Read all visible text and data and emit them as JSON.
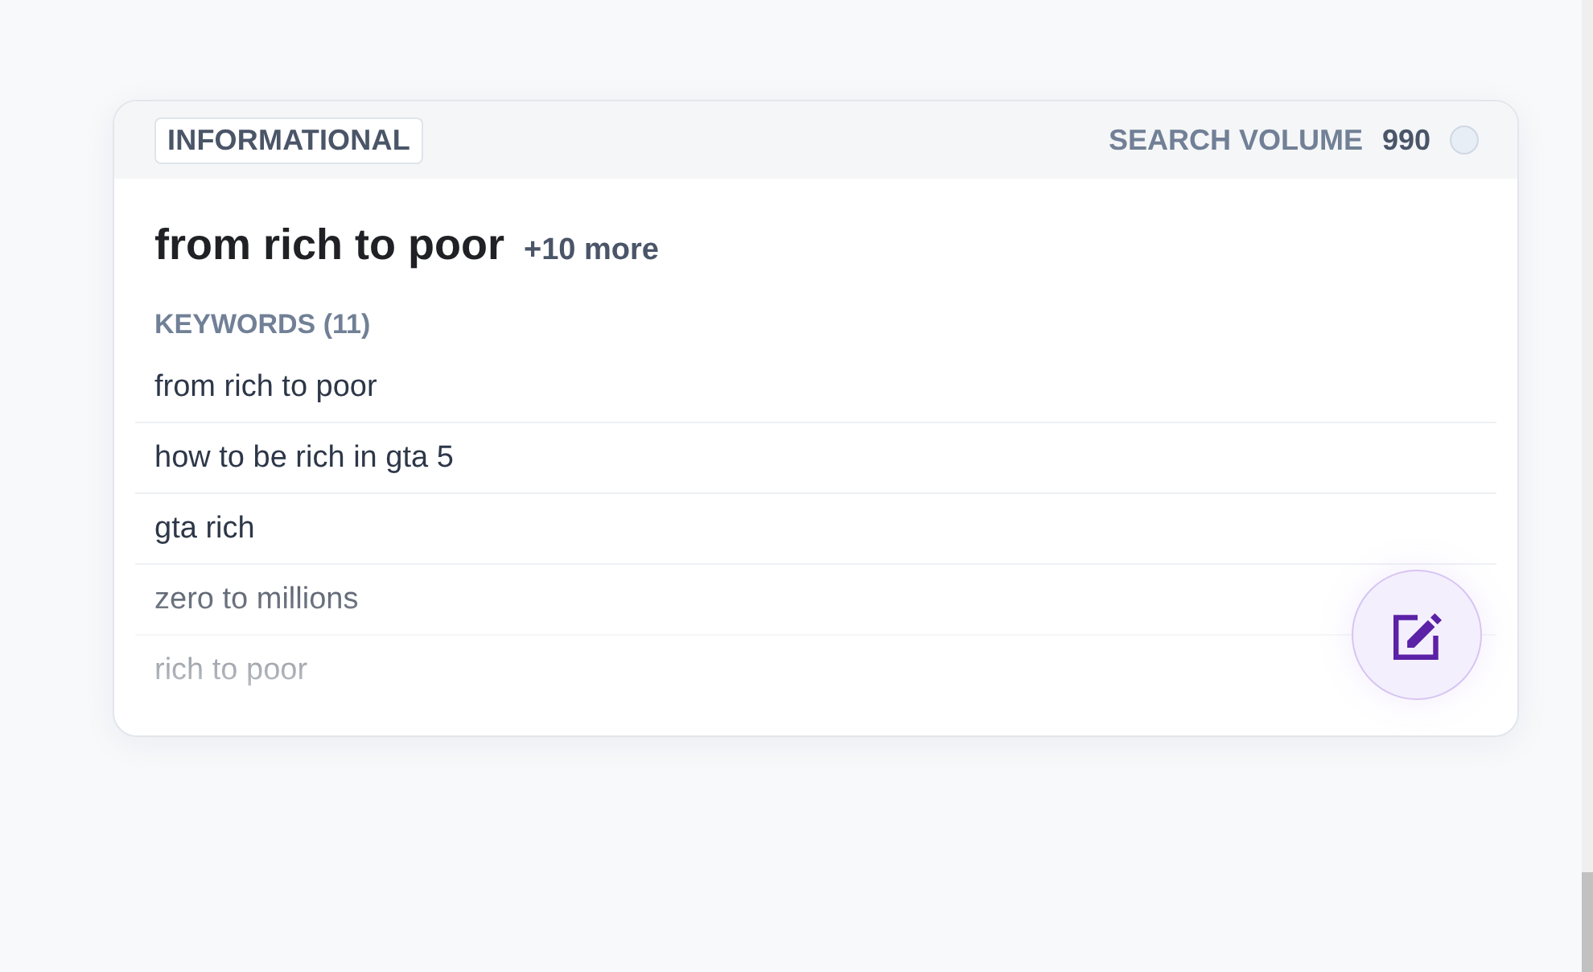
{
  "card": {
    "intent_badge": "INFORMATIONAL",
    "search_volume": {
      "label": "SEARCH VOLUME",
      "value": "990"
    },
    "title": "from rich to poor",
    "more": "+10 more",
    "keywords_heading": "KEYWORDS (11)",
    "keywords": [
      "from rich to poor",
      "how to be rich in gta 5",
      "gta rich",
      "zero to millions",
      "rich to poor"
    ]
  }
}
